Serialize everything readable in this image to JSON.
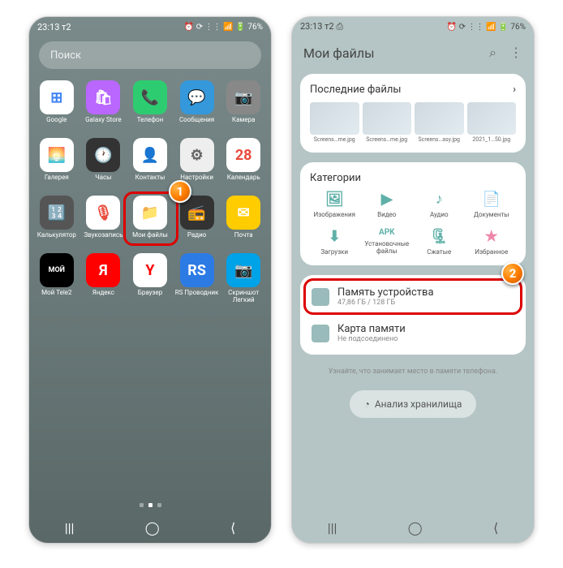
{
  "status": {
    "time": "23:13",
    "carrier": "т2",
    "battery": "76%",
    "icons": "⏰ ⟳ ⋮⋮ 📶 🔋"
  },
  "left": {
    "search_placeholder": "Поиск",
    "apps": [
      {
        "label": "Google",
        "bg": "#fff",
        "glyph": "⊞",
        "color": "#4285f4"
      },
      {
        "label": "Galaxy Store",
        "bg": "#b967ff",
        "glyph": "🛍"
      },
      {
        "label": "Телефон",
        "bg": "#2ecc71",
        "glyph": "📞"
      },
      {
        "label": "Сообщения",
        "bg": "#3498db",
        "glyph": "💬"
      },
      {
        "label": "Камера",
        "bg": "#888",
        "glyph": "📷"
      },
      {
        "label": "Галерея",
        "bg": "#fff",
        "glyph": "🌅",
        "color": "#e74c3c"
      },
      {
        "label": "Часы",
        "bg": "#333",
        "glyph": "🕐"
      },
      {
        "label": "Контакты",
        "bg": "#fff",
        "glyph": "👤",
        "color": "#e67e22"
      },
      {
        "label": "Настройки",
        "bg": "#eee",
        "glyph": "⚙",
        "color": "#666"
      },
      {
        "label": "Календарь",
        "bg": "#fff",
        "glyph": "28",
        "color": "#e74c3c"
      },
      {
        "label": "Калькулятор",
        "bg": "#555",
        "glyph": "🔢"
      },
      {
        "label": "Звукозапись",
        "bg": "#fff",
        "glyph": "🎙",
        "color": "#e74c3c"
      },
      {
        "label": "Мои файлы",
        "bg": "#fff",
        "glyph": "📁",
        "color": "#5b6ee1"
      },
      {
        "label": "Радио",
        "bg": "#333",
        "glyph": "📻"
      },
      {
        "label": "Почта",
        "bg": "#ffcc00",
        "glyph": "✉"
      },
      {
        "label": "Мой Tele2",
        "bg": "#000",
        "glyph": "МОЙ",
        "color": "#fff"
      },
      {
        "label": "Яндекс",
        "bg": "#f00",
        "glyph": "Я"
      },
      {
        "label": "Браузер",
        "bg": "#fff",
        "glyph": "Y",
        "color": "#f00"
      },
      {
        "label": "RS Проводник",
        "bg": "#2c7be5",
        "glyph": "RS"
      },
      {
        "label": "Скриншот Легкий",
        "bg": "#00a2e8",
        "glyph": "📷"
      }
    ],
    "highlight_index": 12,
    "badge1": "1"
  },
  "right": {
    "title": "Мои файлы",
    "recent_header": "Последние файлы",
    "recent_files": [
      "Screens…me.jpg",
      "Screens…me.jpg",
      "Screens…asy.jpg",
      "2021_1…50.jpg"
    ],
    "categories_header": "Категории",
    "categories": [
      {
        "label": "Изображения",
        "glyph": "🖼",
        "color": "#5fb0a8"
      },
      {
        "label": "Видео",
        "glyph": "▶",
        "color": "#5fb0a8"
      },
      {
        "label": "Аудио",
        "glyph": "♪",
        "color": "#5fb0a8"
      },
      {
        "label": "Документы",
        "glyph": "📄",
        "color": "#5fb0a8"
      },
      {
        "label": "Загрузки",
        "glyph": "⬇",
        "color": "#5fb0a8"
      },
      {
        "label": "Установочные файлы",
        "glyph": "APK",
        "color": "#5fb0a8"
      },
      {
        "label": "Сжатые",
        "glyph": "🗜",
        "color": "#5fb0a8"
      },
      {
        "label": "Избранное",
        "glyph": "★",
        "color": "#e8a"
      }
    ],
    "storage": [
      {
        "title": "Память устройства",
        "sub": "47,86 ГБ / 128 ГБ"
      },
      {
        "title": "Карта памяти",
        "sub": "Не подсоединено"
      }
    ],
    "hint": "Узнайте, что занимает место в памяти телефона.",
    "analyze": "Анализ хранилища",
    "badge2": "2"
  }
}
